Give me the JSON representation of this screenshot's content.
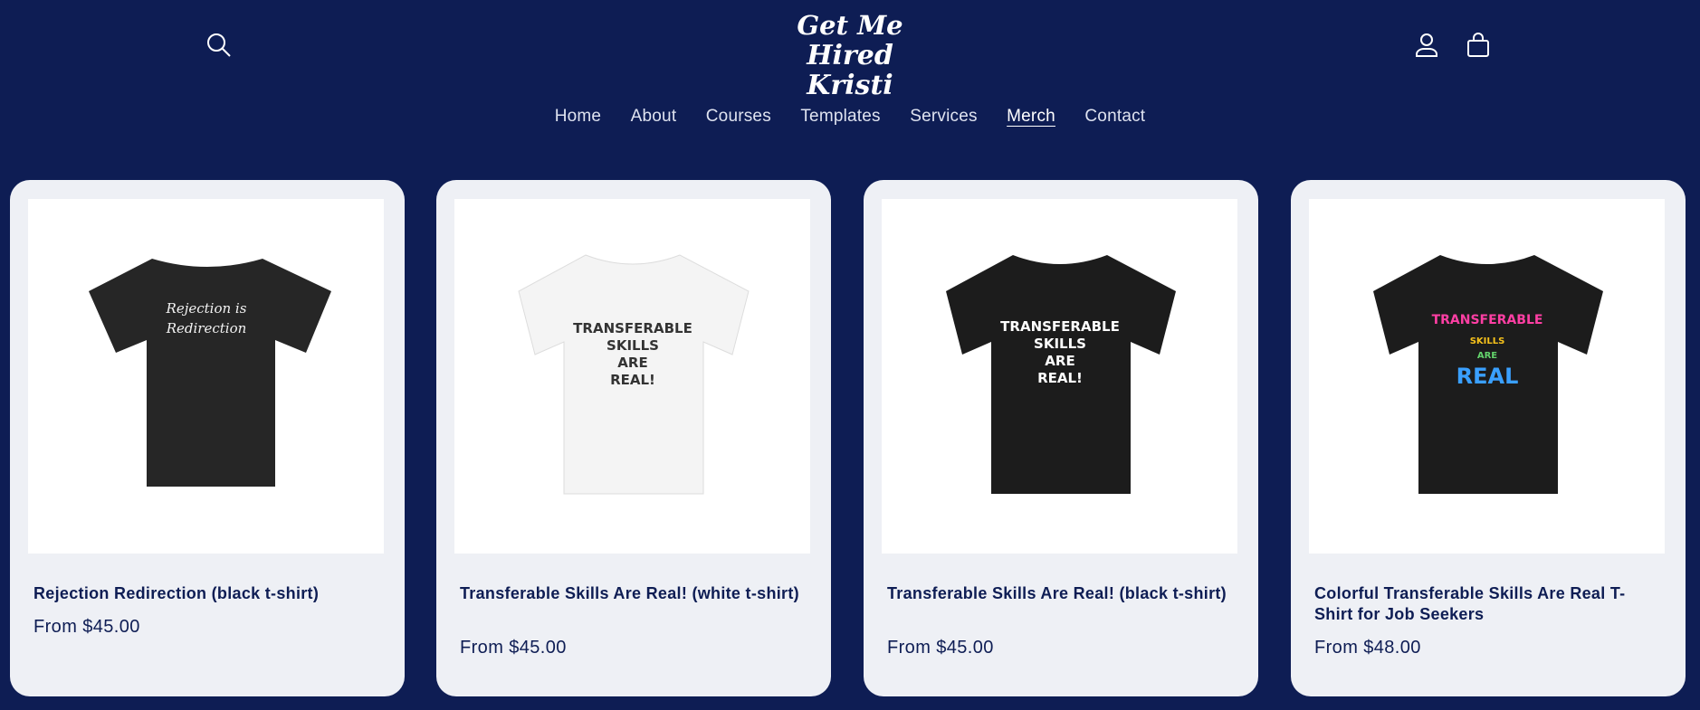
{
  "header": {
    "logo_line1": "Get Me",
    "logo_line2": "Hired Kristi",
    "search_icon": "search-icon",
    "account_icon": "user-icon",
    "cart_icon": "cart-icon"
  },
  "nav": {
    "items": [
      {
        "label": "Home"
      },
      {
        "label": "About"
      },
      {
        "label": "Courses"
      },
      {
        "label": "Templates"
      },
      {
        "label": "Services"
      },
      {
        "label": "Merch"
      },
      {
        "label": "Contact"
      }
    ],
    "active": "Merch"
  },
  "products": [
    {
      "title": "Rejection Redirection (black t-shirt)",
      "price": "From $45.00",
      "shirt_color": "#262626",
      "print_lines": [
        "Rejection is",
        "Redirection"
      ]
    },
    {
      "title": "Transferable Skills Are Real! (white t-shirt)",
      "price": "From $45.00",
      "shirt_color": "#f4f4f4",
      "print_lines": [
        "TRANSFERABLE",
        "SKILLS",
        "ARE",
        "REAL!"
      ]
    },
    {
      "title": "Transferable Skills Are Real! (black t-shirt)",
      "price": "From $45.00",
      "shirt_color": "#1c1c1c",
      "print_lines": [
        "TRANSFERABLE",
        "SKILLS",
        "ARE",
        "REAL!"
      ]
    },
    {
      "title": "Colorful Transferable Skills Are Real T-Shirt for Job Seekers",
      "price": "From $48.00",
      "shirt_color": "#1c1c1c",
      "print_lines": [
        "TRANSFERABLE",
        "SKILLS",
        "ARE",
        "REAL"
      ]
    }
  ],
  "colors": {
    "background": "#0e1d54",
    "card": "#eef0f5",
    "text": "#0e1d54",
    "colorful_print": [
      "#ff3fa4",
      "#3aa0ff",
      "#f7c21b",
      "#63d26b"
    ]
  }
}
